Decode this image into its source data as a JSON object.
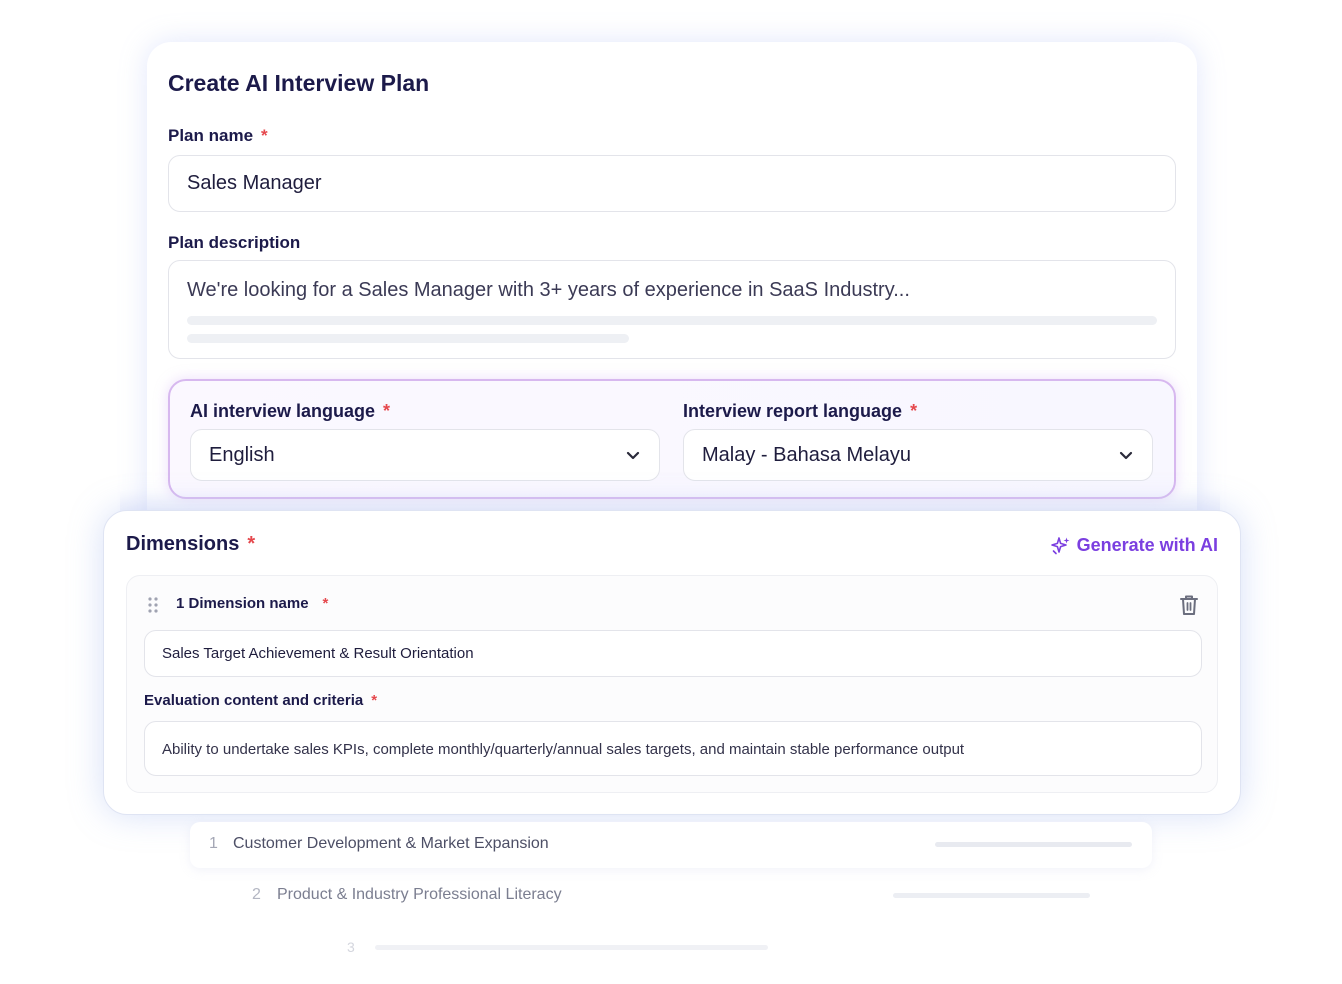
{
  "form": {
    "title": "Create AI Interview Plan",
    "plan_name_label": "Plan name",
    "plan_name_value": "Sales Manager",
    "plan_description_label": "Plan description",
    "plan_description_value": "We're looking for a Sales Manager with 3+ years of experience in SaaS Industry...",
    "required_mark": "*",
    "ai_language_label": "AI interview language",
    "ai_language_value": "English",
    "report_language_label": "Interview report language",
    "report_language_value": "Malay - Bahasa Melayu"
  },
  "dimensions": {
    "title": "Dimensions",
    "generate_label": "Generate with AI",
    "item": {
      "name_label": "1 Dimension name",
      "name_value": "Sales Target Achievement & Result Orientation",
      "criteria_label": "Evaluation content and criteria",
      "criteria_value": "Ability to undertake sales KPIs, complete monthly/quarterly/annual sales targets, and maintain stable performance output"
    },
    "list": [
      {
        "number": "1",
        "label": "Customer Development & Market Expansion"
      },
      {
        "number": "2",
        "label": "Product & Industry Professional Literacy"
      },
      {
        "number": "3",
        "label": ""
      }
    ]
  },
  "colors": {
    "accent": "#7b3fe0",
    "required": "#e5484d",
    "highlight_border": "#d7b8ef"
  },
  "icons": [
    "chevron-down-icon",
    "sparkle-icon",
    "drag-handle-icon",
    "trash-icon"
  ]
}
